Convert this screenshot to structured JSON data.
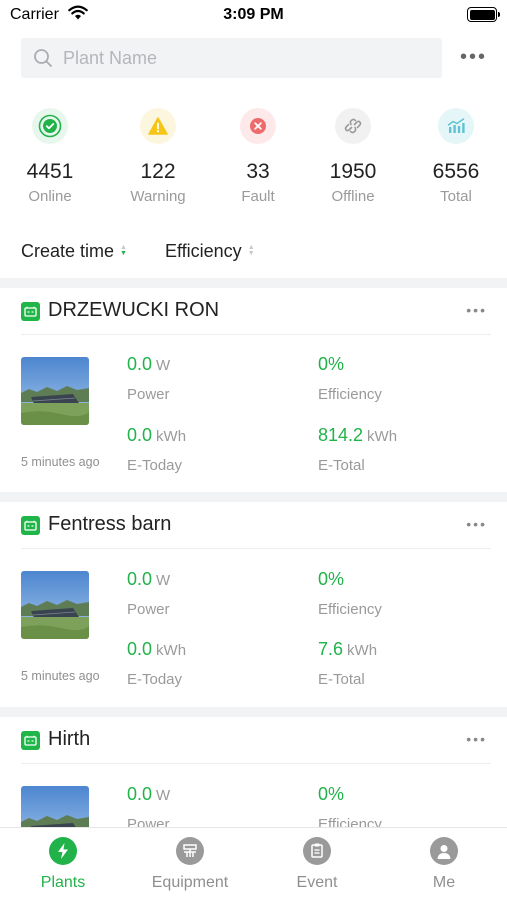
{
  "status_bar": {
    "carrier": "Carrier",
    "time": "3:09 PM"
  },
  "search": {
    "placeholder": "Plant Name",
    "value": ""
  },
  "summary": [
    {
      "count": "4451",
      "label": "Online",
      "color": "#21b34a"
    },
    {
      "count": "122",
      "label": "Warning",
      "color": "#f5c518"
    },
    {
      "count": "33",
      "label": "Fault",
      "color": "#ee6b6b"
    },
    {
      "count": "1950",
      "label": "Offline",
      "color": "#9a9a9a"
    },
    {
      "count": "6556",
      "label": "Total",
      "color": "#5fc3d4"
    }
  ],
  "sort": {
    "create_time": "Create time",
    "efficiency": "Efficiency",
    "active_sort": "create_time"
  },
  "plants": [
    {
      "name": "DRZEWUCKI RON",
      "updated": "5 minutes ago",
      "power": "0.0",
      "power_unit": "W",
      "power_label": "Power",
      "efficiency": "0%",
      "efficiency_label": "Efficiency",
      "e_today": "0.0",
      "e_today_unit": "kWh",
      "e_today_label": "E-Today",
      "e_total": "814.2",
      "e_total_unit": "kWh",
      "e_total_label": "E-Total"
    },
    {
      "name": "Fentress barn",
      "updated": "5 minutes ago",
      "power": "0.0",
      "power_unit": "W",
      "power_label": "Power",
      "efficiency": "0%",
      "efficiency_label": "Efficiency",
      "e_today": "0.0",
      "e_today_unit": "kWh",
      "e_today_label": "E-Today",
      "e_total": "7.6",
      "e_total_unit": "kWh",
      "e_total_label": "E-Total"
    },
    {
      "name": "Hirth",
      "power": "0.0",
      "power_unit": "W",
      "power_label": "Power",
      "efficiency": "0%",
      "efficiency_label": "Efficiency"
    }
  ],
  "tabs": [
    {
      "label": "Plants",
      "icon": "lightning-bolt-icon",
      "active": true
    },
    {
      "label": "Equipment",
      "icon": "equipment-icon",
      "active": false
    },
    {
      "label": "Event",
      "icon": "clipboard-icon",
      "active": false
    },
    {
      "label": "Me",
      "icon": "person-icon",
      "active": false
    }
  ],
  "colors": {
    "accent": "#21b34a",
    "muted": "#9a9a9a",
    "band": "#f2f3f5"
  }
}
